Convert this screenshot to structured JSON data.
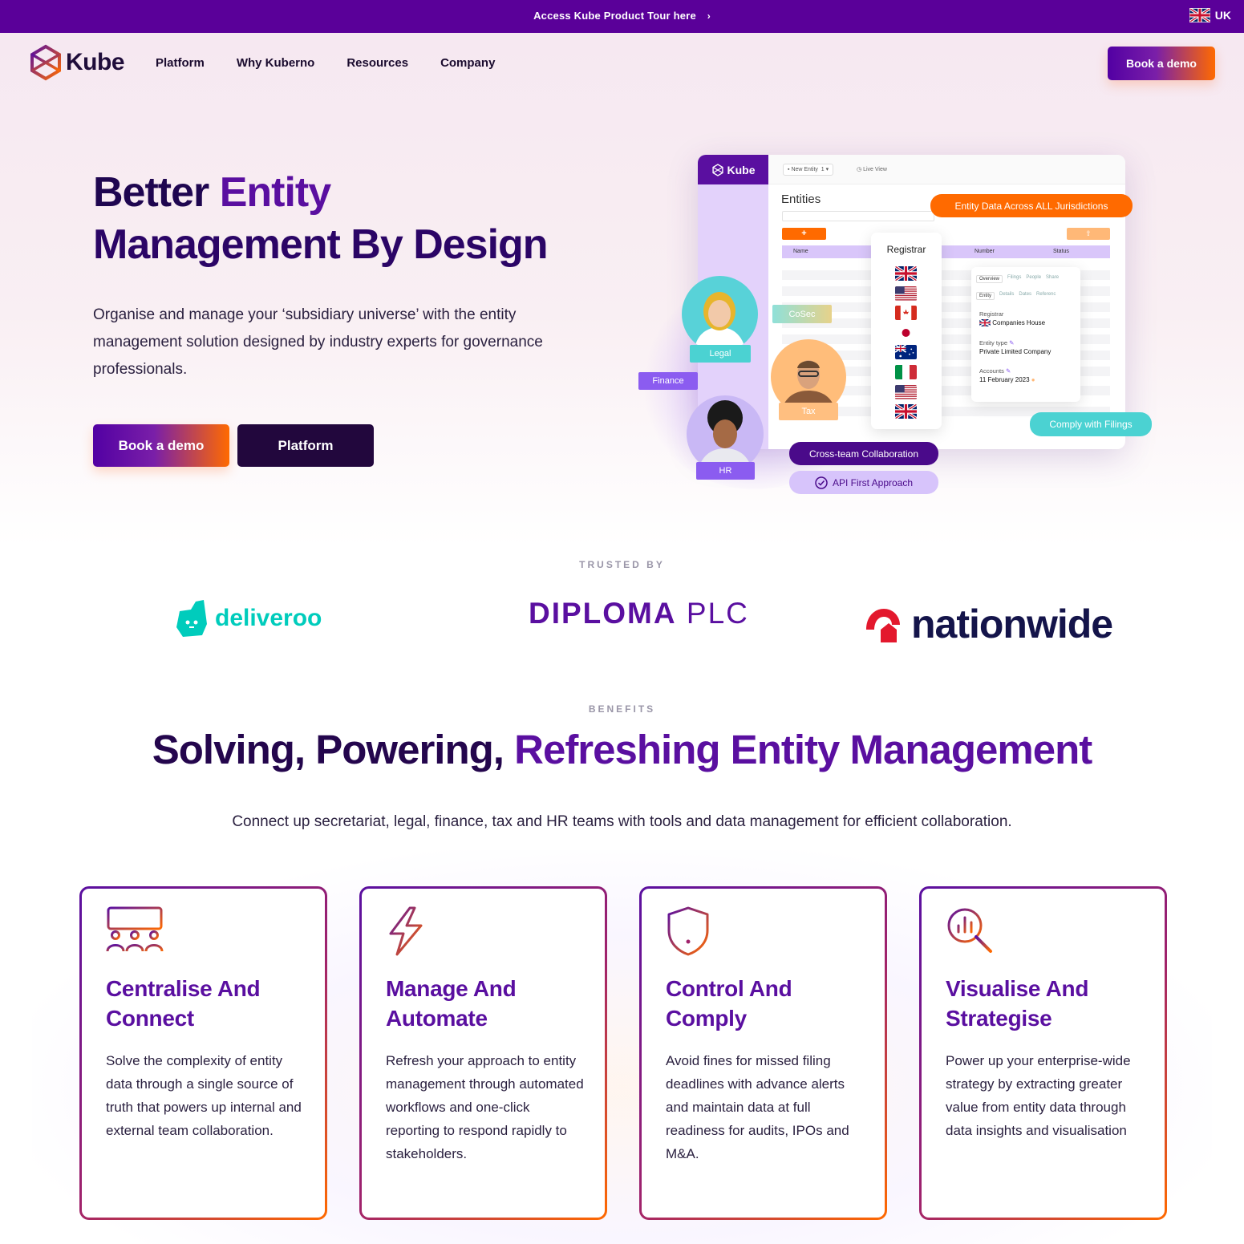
{
  "topbar": {
    "tour_text": "Access Kube Product Tour here",
    "locale": "UK"
  },
  "nav": {
    "brand": "Kube",
    "links": [
      "Platform",
      "Why Kuberno",
      "Resources",
      "Company"
    ],
    "cta": "Book a demo"
  },
  "hero": {
    "title_line1_a": "Better",
    "title_line1_b": "Entity",
    "title_line2": "Management By Design",
    "subtitle": "Organise and manage your ‘subsidiary universe’ with the entity management solution designed by industry experts for governance professionals.",
    "btn_demo": "Book a demo",
    "btn_platform": "Platform"
  },
  "mock": {
    "brand": "Kube",
    "new_entity": "New Entity",
    "new_entity_count": "1",
    "live_view": "Live View",
    "entities_title": "Entities",
    "plus": "+",
    "upload": "⇧",
    "columns": [
      "Name",
      "Number",
      "Status"
    ],
    "registrar_title": "Registrar",
    "detail_tabs": [
      "Overview",
      "Filings",
      "People",
      "Share"
    ],
    "detail_tabs2": [
      "Entity",
      "Details",
      "Dates",
      "Referenc"
    ],
    "detail_registrar_label": "Registrar",
    "detail_registrar_value": "Companies House",
    "detail_type_label": "Entity type",
    "detail_type_value": "Private Limited Company",
    "detail_accounts_label": "Accounts",
    "detail_accounts_value": "11 February 2023",
    "pill_jurisdictions": "Entity Data Across ALL Jurisdictions",
    "pill_filings": "Comply with Filings",
    "pill_collab": "Cross-team Collaboration",
    "pill_api": "API First Approach",
    "tags": {
      "cosec": "CoSec",
      "legal": "Legal",
      "finance": "Finance",
      "tax": "Tax",
      "hr": "HR"
    }
  },
  "trusted": {
    "label": "TRUSTED BY",
    "logos": {
      "deliveroo": "deliveroo",
      "diploma_a": "DIPLOMA",
      "diploma_b": "PLC",
      "nationwide": "nationwide"
    }
  },
  "benefits": {
    "label": "BENEFITS",
    "title_a": "Solving, Powering,",
    "title_b": "Refreshing Entity Management",
    "subtitle": "Connect up secretariat, legal, finance, tax and HR teams with tools and data management for efficient collaboration.",
    "cards": [
      {
        "icon": "team-board-icon",
        "title": "Centralise And Connect",
        "text": "Solve the complexity of entity data through a single source of truth that powers up internal and external team collaboration."
      },
      {
        "icon": "lightning-icon",
        "title": "Manage And Automate",
        "text": "Refresh your approach to entity management through automated workflows and one-click reporting to respond rapidly to stakeholders."
      },
      {
        "icon": "shield-alert-icon",
        "title": "Control And Comply",
        "text": "Avoid fines for missed filing deadlines with advance alerts and maintain data at full readiness for audits, IPOs and M&A."
      },
      {
        "icon": "search-chart-icon",
        "title": "Visualise And Strategise",
        "text": "Power up your enterprise-wide strategy by extracting greater value from entity data through data insights and visualisation"
      }
    ]
  },
  "colors": {
    "brand_purple": "#5a0fa0",
    "topbar": "#5a0099",
    "accent_orange": "#ff6a00",
    "teal": "#4bd2d2"
  }
}
